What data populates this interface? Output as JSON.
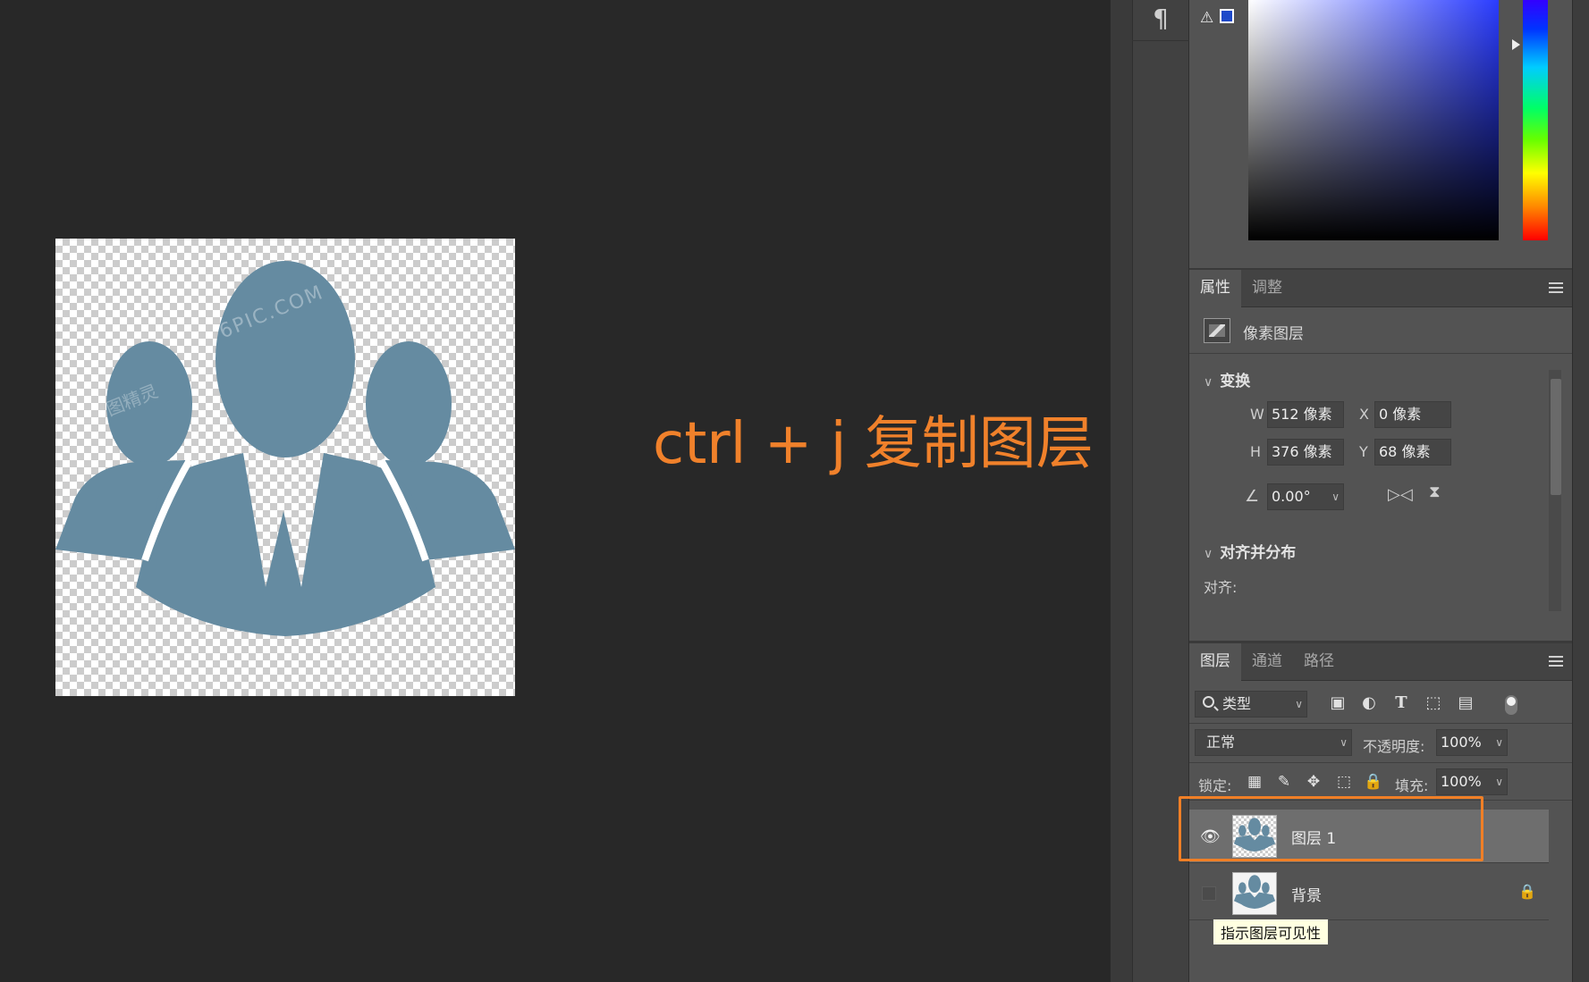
{
  "canvas": {
    "caption": "ctrl + j  复制图层",
    "figure_color": "#658ba1",
    "accent": "#f0812b"
  },
  "dock": {
    "paragraph_icon": "¶"
  },
  "color_panel": {
    "warning_icon": "⚠",
    "field_color": "#2a3cff"
  },
  "properties": {
    "tabs": [
      "属性",
      "调整"
    ],
    "layer_kind": "像素图层",
    "transform": {
      "heading": "变换",
      "w_label": "W",
      "w_value": "512 像素",
      "x_label": "X",
      "x_value": "0 像素",
      "h_label": "H",
      "h_value": "376 像素",
      "y_label": "Y",
      "y_value": "68 像素",
      "angle_value": "0.00°"
    },
    "align": {
      "heading": "对齐并分布",
      "align_label": "对齐:"
    }
  },
  "layers_panel": {
    "tabs": [
      "图层",
      "通道",
      "路径"
    ],
    "filter_type": "类型",
    "blend_mode": "正常",
    "opacity_label": "不透明度:",
    "opacity_value": "100%",
    "lock_label": "锁定:",
    "fill_label": "填充:",
    "fill_value": "100%",
    "layers": [
      {
        "name": "图层 1",
        "visible": true,
        "selected": true
      },
      {
        "name": "背景",
        "visible": false,
        "locked": true
      }
    ],
    "tooltip": "指示图层可见性"
  }
}
